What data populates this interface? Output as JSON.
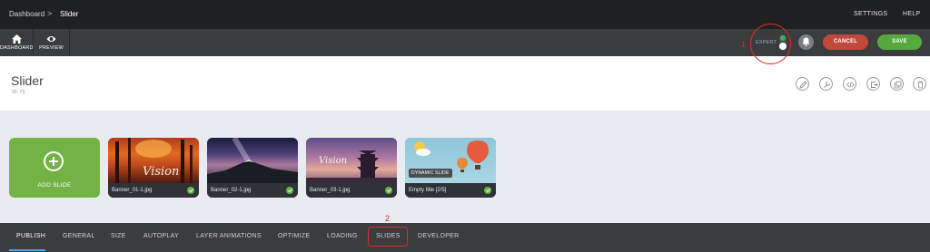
{
  "breadcrumb": {
    "root": "Dashboard",
    "separator": ">",
    "current": "Slider"
  },
  "top_links": {
    "settings": "SETTINGS",
    "help": "HELP"
  },
  "toolbar": {
    "dashboard_label": "DASHBOARD",
    "preview_label": "PREVIEW",
    "expert_label": "EXPERT",
    "cancel_label": "CANCEL",
    "save_label": "SAVE"
  },
  "annotations": {
    "marker_1": "1",
    "marker_2": "2",
    "color": "#d93025"
  },
  "header": {
    "title": "Slider",
    "id_text": "ID: 73"
  },
  "header_actions": [
    "pencil-icon",
    "wrench-icon",
    "code-icon",
    "export-icon",
    "duplicate-icon",
    "trash-icon"
  ],
  "add_slide_label": "ADD SLIDE",
  "slides": [
    {
      "label": "Banner_01-1.jpg",
      "status": "ok",
      "thumb_text": "Vision"
    },
    {
      "label": "Banner_02-1.jpg",
      "status": "ok"
    },
    {
      "label": "Banner_03-1.jpg",
      "status": "ok",
      "thumb_text": "Vision"
    },
    {
      "label": "Empty title [2/5]",
      "status": "ok",
      "badge": "DYNAMIC SLIDE"
    }
  ],
  "tabs": [
    "PUBLISH",
    "GENERAL",
    "SIZE",
    "AUTOPLAY",
    "LAYER ANIMATIONS",
    "OPTIMIZE",
    "LOADING",
    "SLIDES",
    "DEVELOPER"
  ],
  "active_tab": "PUBLISH",
  "colors": {
    "cancel": "#c0493b",
    "save": "#56a93f",
    "add_slide": "#73b244",
    "check": "#66b744",
    "active_tab_underline": "#4aa5e0"
  }
}
